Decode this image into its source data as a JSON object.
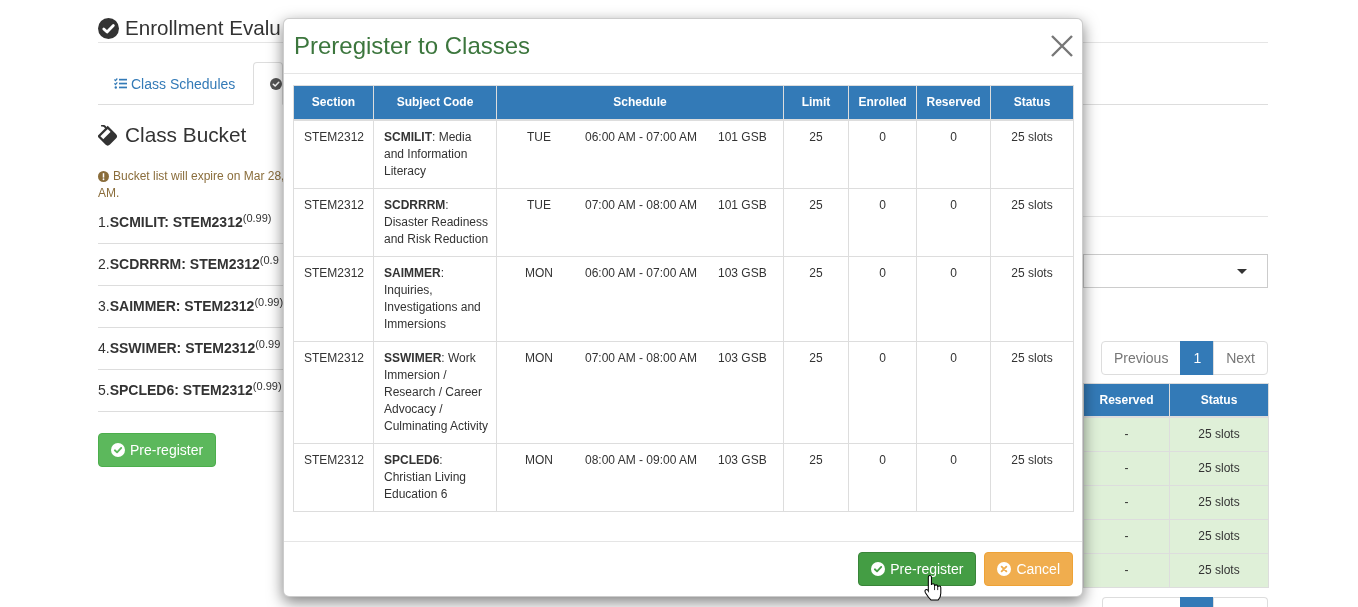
{
  "page": {
    "title": "Enrollment Evalu"
  },
  "tabs": [
    {
      "label": "Class Schedules",
      "selected": false
    },
    {
      "selected": true
    }
  ],
  "bucket": {
    "heading": "Class Bucket",
    "notice": [
      "Bucket list will expire on Mar 28,",
      "AM."
    ],
    "items": [
      "1.**SCMILIT: STEM2312**$^{(0.99)}$",
      "2.**SCDRRRM: STEM2312**$^{(0.9}$",
      "3.**SAIMMER: STEM2312**$^{(0.99)}$",
      "4.**SSWIMER: STEM2312**$^{(0.99}$",
      "5.**SPCLED6: STEM2312**$^{(0.99)}$"
    ],
    "button": "Pre-register"
  },
  "class_list": {
    "pagination": [
      {
        "label": "Previous",
        "selected": false,
        "disabled": true
      },
      {
        "label": "1",
        "selected": true,
        "disabled": false
      },
      {
        "label": "Next",
        "selected": false,
        "disabled": true
      }
    ],
    "columns": [
      "Reserved",
      "Status"
    ],
    "rows": [
      {
        "reserved": "-",
        "status": "25 slots"
      },
      {
        "reserved": "-",
        "status": "25 slots"
      },
      {
        "reserved": "-",
        "status": "25 slots"
      },
      {
        "reserved": "-",
        "status": "25 slots"
      },
      {
        "reserved": "-",
        "status": "25 slots"
      }
    ],
    "bottom_pagination": [
      {
        "selected": false
      },
      {
        "selected": true
      },
      {
        "selected": false
      }
    ]
  },
  "modal": {
    "title": "Preregister to Classes",
    "columns": [
      "Section",
      "Subject Code",
      "Schedule",
      "Limit",
      "Enrolled",
      "Reserved",
      "Status"
    ],
    "rows": [
      {
        "section": "STEM2312",
        "subject": "**SCMILIT**: Media and Information Literacy",
        "schedule": {
          "day": "TUE",
          "time": "06:00 AM - 07:00 AM",
          "room": "101 GSB"
        },
        "limit": "25",
        "enrolled": "0",
        "reserved": "0",
        "status": "25 slots"
      },
      {
        "section": "STEM2312",
        "subject": "**SCDRRRM**: Disaster Readiness and Risk Reduction",
        "schedule": {
          "day": "TUE",
          "time": "07:00 AM - 08:00 AM",
          "room": "101 GSB"
        },
        "limit": "25",
        "enrolled": "0",
        "reserved": "0",
        "status": "25 slots"
      },
      {
        "section": "STEM2312",
        "subject": "**SAIMMER**: Inquiries, Investigations and Immersions",
        "schedule": {
          "day": "MON",
          "time": "06:00 AM - 07:00 AM",
          "room": "103 GSB"
        },
        "limit": "25",
        "enrolled": "0",
        "reserved": "0",
        "status": "25 slots"
      },
      {
        "section": "STEM2312",
        "subject": "**SSWIMER**: Work Immersion / Research / Career Advocacy / Culminating Activity",
        "schedule": {
          "day": "MON",
          "time": "07:00 AM - 08:00 AM",
          "room": "103 GSB"
        },
        "limit": "25",
        "enrolled": "0",
        "reserved": "0",
        "status": "25 slots"
      },
      {
        "section": "STEM2312",
        "subject": "**SPCLED6**: Christian Living Education 6",
        "schedule": {
          "day": "MON",
          "time": "08:00 AM - 09:00 AM",
          "room": "103 GSB"
        },
        "limit": "25",
        "enrolled": "0",
        "reserved": "0",
        "status": "25 slots"
      }
    ],
    "buttons": [
      {
        "label": "Pre-register",
        "kind": "success",
        "hovered": true
      },
      {
        "label": "Cancel",
        "kind": "warning",
        "hovered": false
      }
    ]
  }
}
